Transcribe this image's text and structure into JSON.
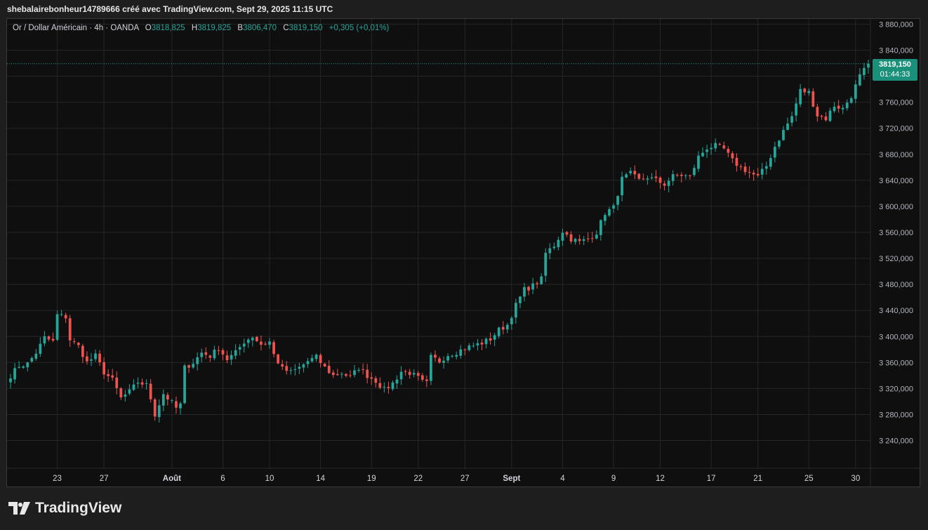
{
  "header": {
    "text": "shebalairebonheur14789666 créé avec TradingView.com, Sept 29, 2025 11:15 UTC"
  },
  "legend": {
    "symbol": "Or / Dollar Américain · 4h · OANDA",
    "o_label": "O",
    "o_value": "3818,825",
    "h_label": "H",
    "h_value": "3819,825",
    "b_label": "B",
    "b_value": "3806,470",
    "c_label": "C",
    "c_value": "3819,150",
    "change": "+0,305 (+0,01%)"
  },
  "price_tag": {
    "price": "3819,150",
    "countdown": "01:44:33"
  },
  "footer": {
    "brand": "TradingView"
  },
  "colors": {
    "up": "#26a69a",
    "down": "#ef5350",
    "background": "#0f0f0f",
    "grid": "#262626"
  },
  "chart_data": {
    "type": "candlestick",
    "title": "Or / Dollar Américain · 4h · OANDA",
    "ylim": [
      3205,
      3888
    ],
    "y_ticks": [
      "3 880,000",
      "3 840,000",
      "3 800,000",
      "3 760,000",
      "3 720,000",
      "3 680,000",
      "3 640,000",
      "3 600,000",
      "3 560,000",
      "3 520,000",
      "3 480,000",
      "3 440,000",
      "3 400,000",
      "3 360,000",
      "3 320,000",
      "3 280,000",
      "3 240,000"
    ],
    "y_tick_values": [
      3880,
      3840,
      3800,
      3760,
      3720,
      3680,
      3640,
      3600,
      3560,
      3520,
      3480,
      3440,
      3400,
      3360,
      3320,
      3280,
      3240
    ],
    "x_ticks": [
      "23",
      "27",
      "Août",
      "6",
      "10",
      "14",
      "19",
      "22",
      "27",
      "Sept",
      "4",
      "9",
      "12",
      "17",
      "21",
      "25",
      "30"
    ],
    "x_tick_bar_index": [
      11,
      22,
      38,
      50,
      61,
      73,
      85,
      96,
      107,
      118,
      130,
      142,
      153,
      165,
      176,
      188,
      199
    ],
    "current_price": 3819.15,
    "close_path": [
      [
        0,
        3340
      ],
      [
        2,
        3355
      ],
      [
        4,
        3358
      ],
      [
        6,
        3375
      ],
      [
        8,
        3398
      ],
      [
        10,
        3392
      ],
      [
        11,
        3433
      ],
      [
        13,
        3430
      ],
      [
        14,
        3395
      ],
      [
        16,
        3385
      ],
      [
        18,
        3360
      ],
      [
        20,
        3370
      ],
      [
        22,
        3345
      ],
      [
        24,
        3333
      ],
      [
        26,
        3305
      ],
      [
        28,
        3315
      ],
      [
        30,
        3330
      ],
      [
        32,
        3325
      ],
      [
        33,
        3305
      ],
      [
        34,
        3280
      ],
      [
        36,
        3312
      ],
      [
        38,
        3298
      ],
      [
        39,
        3290
      ],
      [
        40,
        3295
      ],
      [
        41,
        3352
      ],
      [
        43,
        3360
      ],
      [
        45,
        3375
      ],
      [
        47,
        3370
      ],
      [
        49,
        3382
      ],
      [
        51,
        3365
      ],
      [
        53,
        3375
      ],
      [
        55,
        3392
      ],
      [
        57,
        3400
      ],
      [
        59,
        3388
      ],
      [
        61,
        3392
      ],
      [
        62,
        3372
      ],
      [
        64,
        3350
      ],
      [
        66,
        3345
      ],
      [
        68,
        3352
      ],
      [
        70,
        3362
      ],
      [
        72,
        3368
      ],
      [
        74,
        3352
      ],
      [
        76,
        3340
      ],
      [
        78,
        3344
      ],
      [
        80,
        3337
      ],
      [
        82,
        3352
      ],
      [
        84,
        3340
      ],
      [
        86,
        3332
      ],
      [
        88,
        3318
      ],
      [
        90,
        3328
      ],
      [
        92,
        3346
      ],
      [
        94,
        3344
      ],
      [
        96,
        3336
      ],
      [
        97,
        3330
      ],
      [
        98,
        3328
      ],
      [
        99,
        3368
      ],
      [
        101,
        3362
      ],
      [
        103,
        3372
      ],
      [
        105,
        3376
      ],
      [
        107,
        3382
      ],
      [
        109,
        3386
      ],
      [
        111,
        3390
      ],
      [
        113,
        3396
      ],
      [
        115,
        3410
      ],
      [
        117,
        3418
      ],
      [
        119,
        3448
      ],
      [
        121,
        3472
      ],
      [
        123,
        3478
      ],
      [
        125,
        3488
      ],
      [
        126,
        3528
      ],
      [
        128,
        3540
      ],
      [
        130,
        3562
      ],
      [
        132,
        3550
      ],
      [
        134,
        3545
      ],
      [
        136,
        3550
      ],
      [
        138,
        3560
      ],
      [
        140,
        3590
      ],
      [
        142,
        3598
      ],
      [
        144,
        3642
      ],
      [
        146,
        3650
      ],
      [
        148,
        3640
      ],
      [
        150,
        3645
      ],
      [
        152,
        3640
      ],
      [
        154,
        3634
      ],
      [
        156,
        3646
      ],
      [
        158,
        3648
      ],
      [
        160,
        3645
      ],
      [
        162,
        3676
      ],
      [
        164,
        3690
      ],
      [
        166,
        3693
      ],
      [
        168,
        3688
      ],
      [
        170,
        3670
      ],
      [
        172,
        3660
      ],
      [
        174,
        3652
      ],
      [
        176,
        3645
      ],
      [
        178,
        3662
      ],
      [
        180,
        3692
      ],
      [
        182,
        3716
      ],
      [
        184,
        3738
      ],
      [
        186,
        3778
      ],
      [
        188,
        3775
      ],
      [
        190,
        3740
      ],
      [
        192,
        3735
      ],
      [
        194,
        3755
      ],
      [
        196,
        3750
      ],
      [
        198,
        3770
      ],
      [
        200,
        3800
      ],
      [
        202,
        3818
      ]
    ],
    "x_range_bars": [
      0,
      202
    ]
  }
}
